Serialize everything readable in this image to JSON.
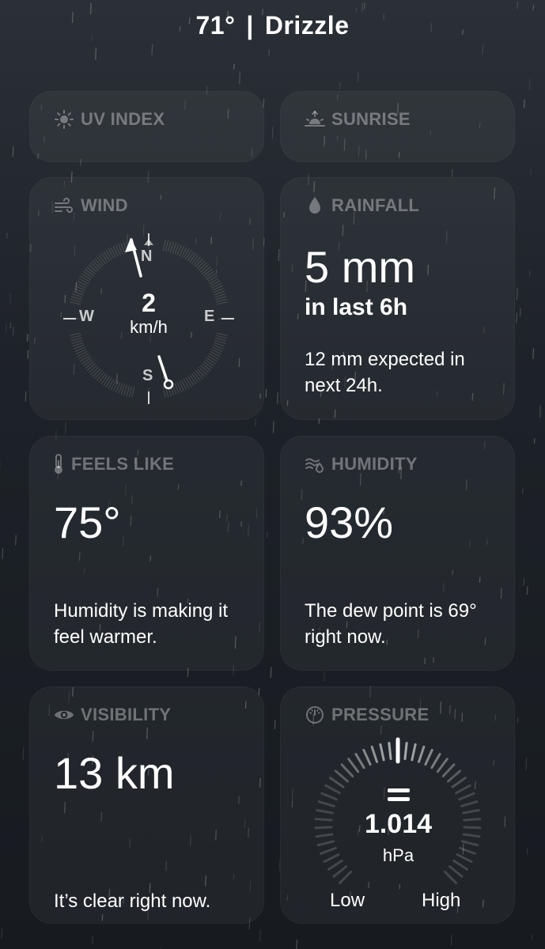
{
  "header": {
    "temperature": "71°",
    "separator": "|",
    "condition": "Drizzle"
  },
  "cards": {
    "uv": {
      "label": "UV INDEX",
      "icon": "sun-icon"
    },
    "sunrise": {
      "label": "SUNRISE",
      "icon": "sunrise-icon"
    },
    "wind": {
      "label": "WIND",
      "icon": "wind-icon",
      "speed": "2",
      "unit": "km/h",
      "directions": {
        "n": "N",
        "s": "S",
        "e": "E",
        "w": "W"
      }
    },
    "rainfall": {
      "label": "RAINFALL",
      "icon": "raindrop-icon",
      "value": "5 mm",
      "period": "in last 6h",
      "description": "12 mm expected in next 24h."
    },
    "feels_like": {
      "label": "FEELS LIKE",
      "icon": "thermometer-icon",
      "value": "75°",
      "description": "Humidity is making it feel warmer."
    },
    "humidity": {
      "label": "HUMIDITY",
      "icon": "humidity-icon",
      "value": "93%",
      "description": "The dew point is 69° right now."
    },
    "visibility": {
      "label": "VISIBILITY",
      "icon": "eye-icon",
      "value": "13 km",
      "description": "It’s clear right now."
    },
    "pressure": {
      "label": "PRESSURE",
      "icon": "gauge-icon",
      "value": "1.014",
      "unit": "hPa",
      "low_label": "Low",
      "high_label": "High",
      "trend_icon": "equals-icon"
    }
  },
  "colors": {
    "background": "#1d2228",
    "card_background": "#262b31",
    "label": "#8a8f95",
    "text": "#ffffff"
  }
}
